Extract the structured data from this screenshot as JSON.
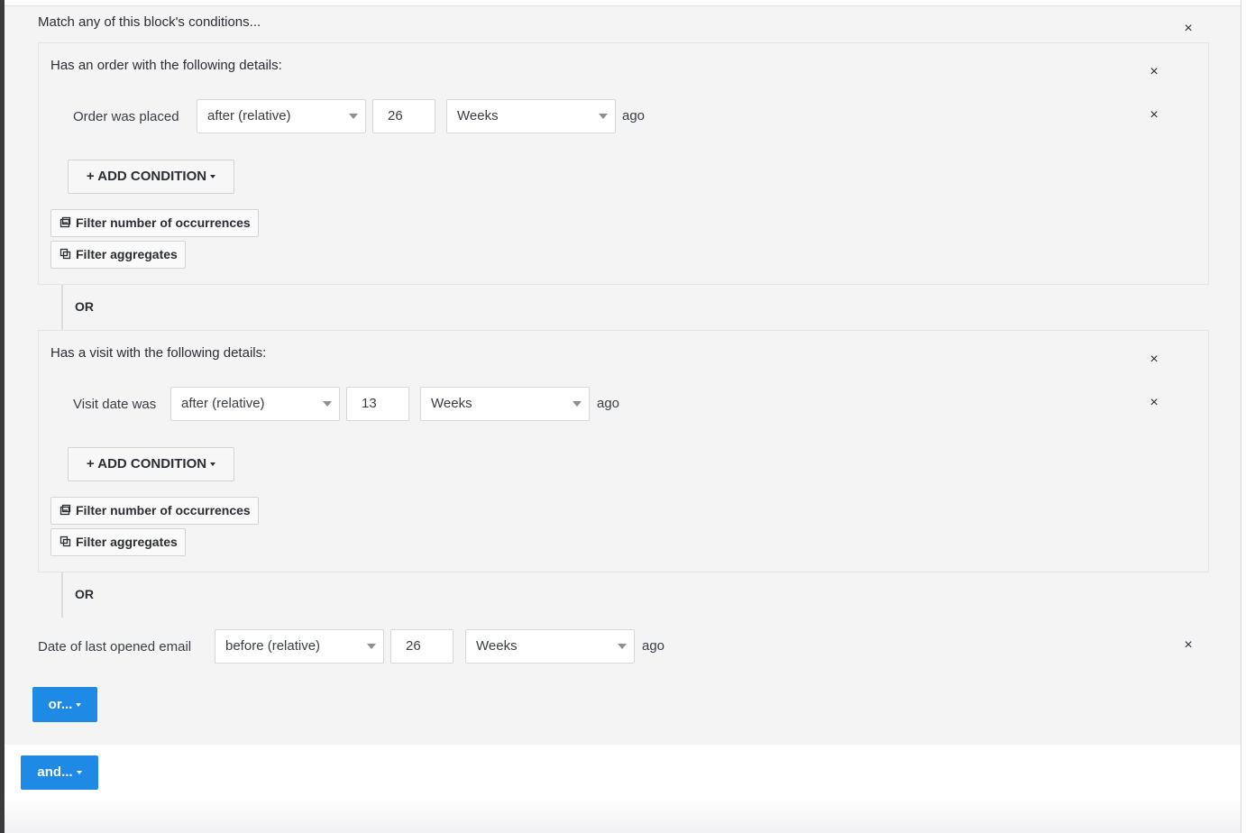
{
  "outer_block": {
    "title": "Match any of this block's conditions...",
    "close_label": "×"
  },
  "order_block": {
    "title": "Has an order with the following details:",
    "close_label": "×",
    "condition": {
      "label": "Order was placed",
      "operator": "after (relative)",
      "value": "26",
      "unit": "Weeks",
      "suffix": "ago",
      "remove_label": "×"
    },
    "add_condition_label": "+ ADD CONDITION",
    "filter_occurrences_label": "Filter number of occurrences",
    "filter_aggregates_label": "Filter aggregates"
  },
  "or_1": "OR",
  "visit_block": {
    "title": "Has a visit with the following details:",
    "close_label": "×",
    "condition": {
      "label": "Visit date was",
      "operator": "after (relative)",
      "value": "13",
      "unit": "Weeks",
      "suffix": "ago",
      "remove_label": "×"
    },
    "add_condition_label": "+ ADD CONDITION",
    "filter_occurrences_label": "Filter number of occurrences",
    "filter_aggregates_label": "Filter aggregates"
  },
  "or_2": "OR",
  "email_condition": {
    "label": "Date of last opened email",
    "operator": "before (relative)",
    "value": "26",
    "unit": "Weeks",
    "suffix": "ago",
    "remove_label": "×"
  },
  "or_button_label": "or...",
  "and_button_label": "and...",
  "colors": {
    "accent_blue": "#1e8ae6",
    "block_bg": "#f4f4f5"
  }
}
